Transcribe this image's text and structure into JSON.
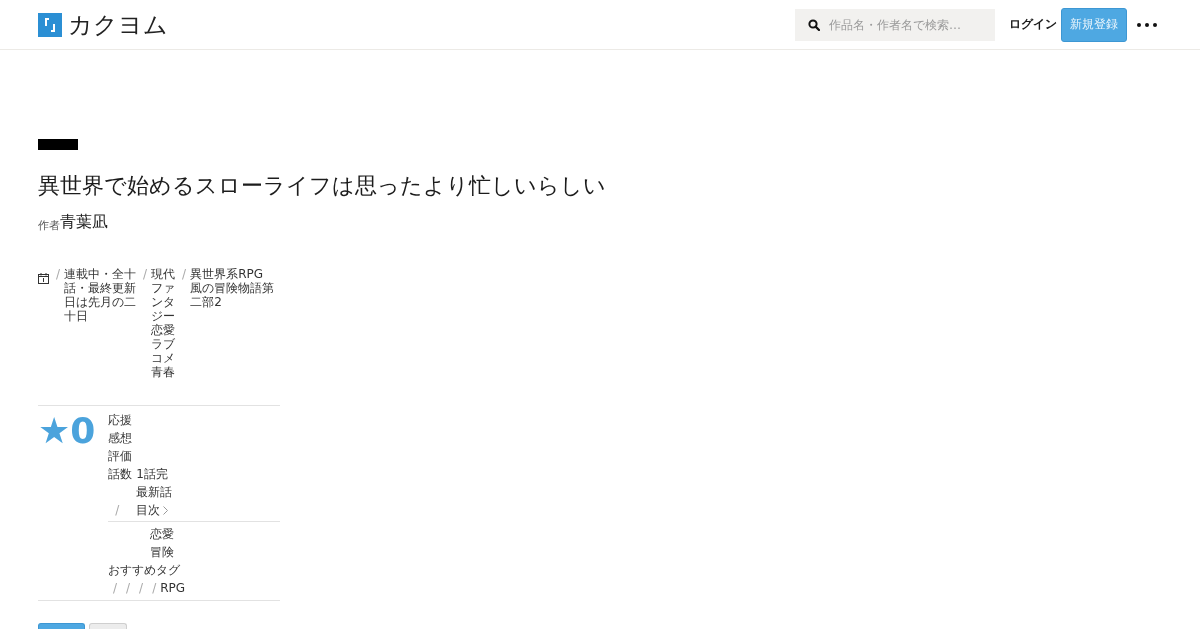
{
  "header": {
    "logo": "カクヨム",
    "search": {
      "placeholder": "作品名・作者名で検索…"
    },
    "nav": [
      {
        "kind": "link",
        "label": "ログイン"
      },
      {
        "kind": "button",
        "label": "新規登録"
      }
    ]
  },
  "work": {
    "title": "異世界で始めるスローライフは思ったより忙しいらしい",
    "author_prefix": "作者",
    "author": "青葉凪",
    "meta": [
      {
        "sep": "/",
        "text": "連載中・全十話・最終更新日は先月の二十日"
      },
      {
        "sep": "/",
        "text": "現代ファンタジー恋愛ラブコメ青春"
      },
      {
        "sep": "/",
        "text": "異世界系RPG風の冒険物語第二部2"
      }
    ],
    "rating": "★0",
    "stats": [
      {
        "label": "応援"
      },
      {
        "label": "感想"
      },
      {
        "label": "評価"
      },
      {
        "label": "話数",
        "value": "1話完"
      }
    ],
    "episode": {
      "title": "最新話",
      "links": [
        {
          "sep": "/",
          "label": "目次"
        }
      ]
    },
    "keywords": {
      "words": [
        "恋愛",
        "冒険"
      ],
      "heading": "おすすめタグ",
      "tags": [
        {
          "sep": "/"
        },
        {
          "sep": "/"
        },
        {
          "sep": "/"
        },
        {
          "sep": "/",
          "label": "RPG"
        }
      ]
    },
    "buttons": [
      {
        "kind": "primary"
      },
      {
        "kind": "secondary"
      }
    ]
  }
}
